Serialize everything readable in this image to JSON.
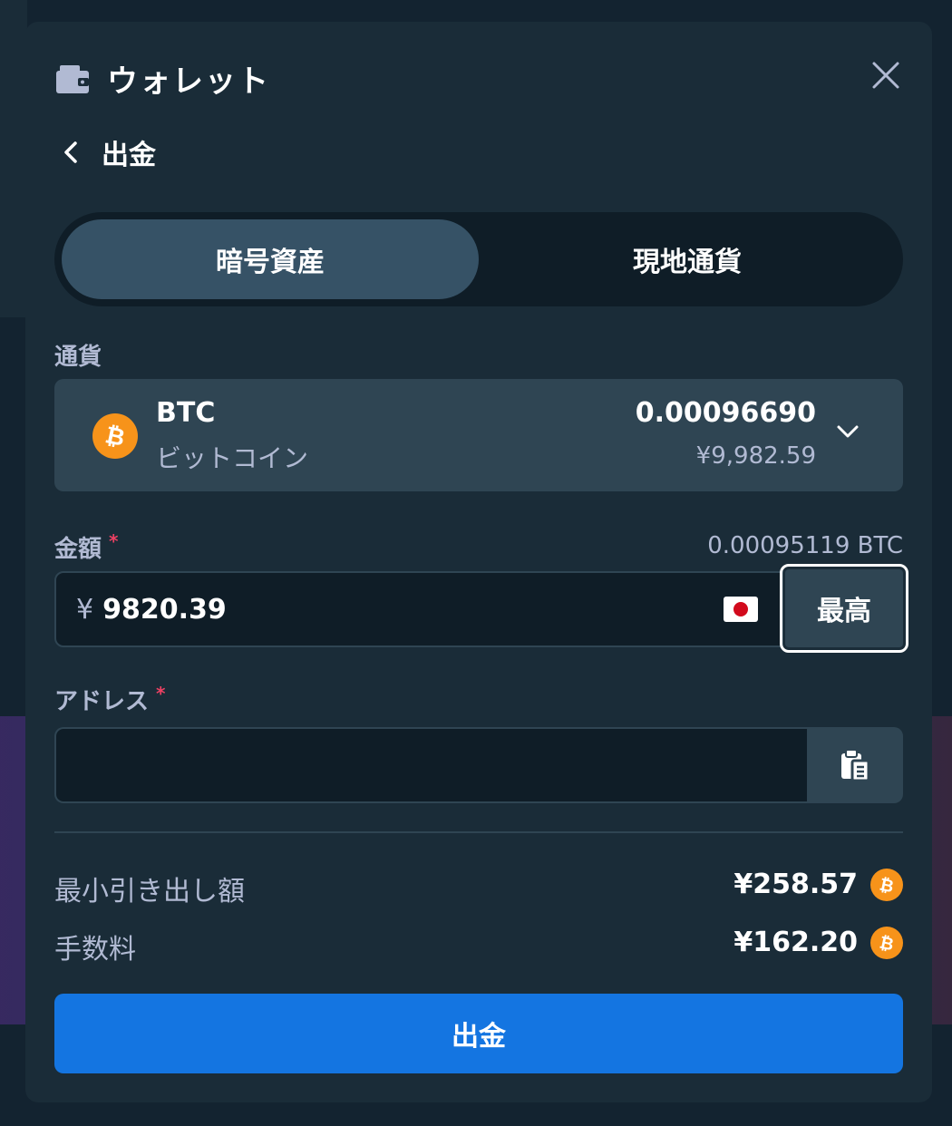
{
  "header": {
    "title": "ウォレット"
  },
  "subheader": {
    "title": "出金"
  },
  "tabs": [
    {
      "label": "暗号資産",
      "active": true
    },
    {
      "label": "現地通貨",
      "active": false
    }
  ],
  "currency": {
    "label": "通貨",
    "code": "BTC",
    "name": "ビットコイン",
    "balance": "0.00096690",
    "balance_fiat": "¥9,982.59",
    "icon": "bitcoin-icon"
  },
  "amount": {
    "label": "金額",
    "required_mark": "*",
    "converted": "0.00095119 BTC",
    "prefix": "¥",
    "value": "9820.39",
    "flag": "japan-flag-icon",
    "max_label": "最高"
  },
  "address": {
    "label": "アドレス",
    "required_mark": "*",
    "value": "",
    "paste_icon": "clipboard-icon"
  },
  "info": [
    {
      "label": "最小引き出し額",
      "value": "¥258.57",
      "icon": "bitcoin-icon"
    },
    {
      "label": "手数料",
      "value": "¥162.20",
      "icon": "bitcoin-icon"
    }
  ],
  "withdraw_button": {
    "label": "出金"
  },
  "colors": {
    "modal_bg": "#1a2c38",
    "field_bg": "#0f1d27",
    "panel_bg": "#2f4553",
    "accent_blue": "#1475e1",
    "bitcoin_orange": "#f7931a",
    "required_red": "#ed4163"
  }
}
